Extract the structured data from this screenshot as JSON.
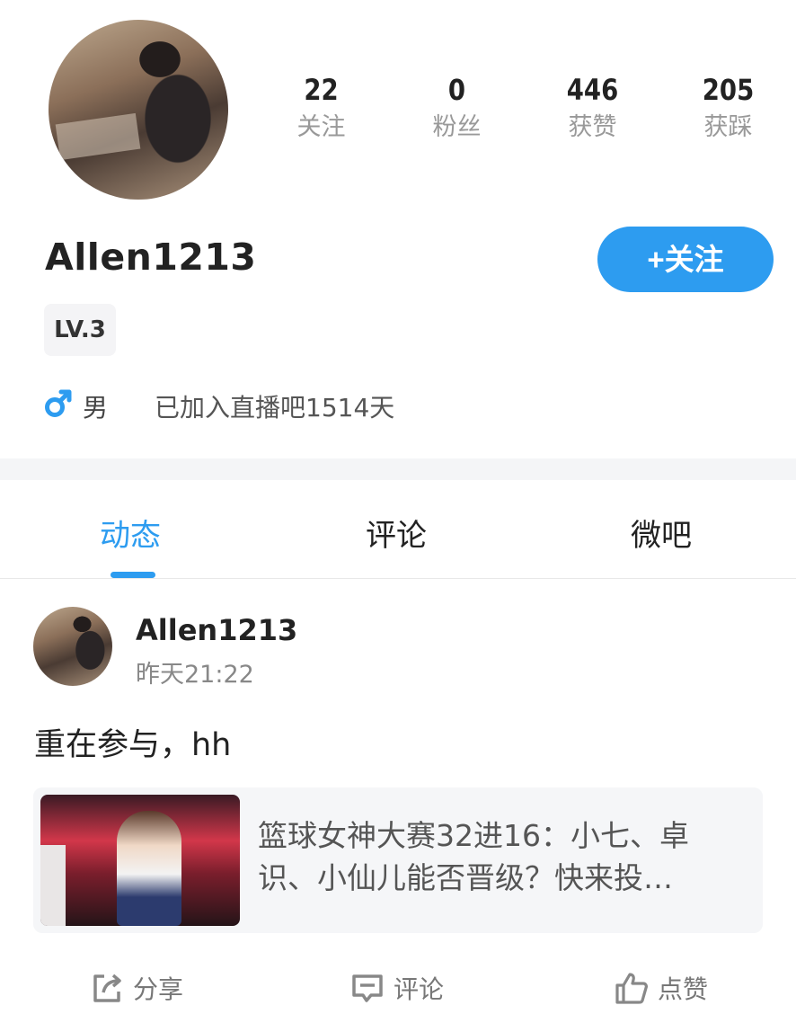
{
  "profile": {
    "username": "Allen1213",
    "level": "LV.3",
    "gender": "男",
    "joined": "已加入直播吧1514天",
    "follow_button": "+关注",
    "stats": [
      {
        "value": "22",
        "label": "关注"
      },
      {
        "value": "0",
        "label": "粉丝"
      },
      {
        "value": "446",
        "label": "获赞"
      },
      {
        "value": "205",
        "label": "获踩"
      }
    ]
  },
  "tabs": [
    {
      "label": "动态",
      "active": true
    },
    {
      "label": "评论",
      "active": false
    },
    {
      "label": "微吧",
      "active": false
    }
  ],
  "post": {
    "author": "Allen1213",
    "time": "昨天21:22",
    "text": "重在参与，hh",
    "link_title": "篮球女神大赛32进16：小七、卓识、小仙儿能否晋级？快来投…",
    "actions": {
      "share": "分享",
      "comment": "评论",
      "like": "点赞"
    }
  },
  "colors": {
    "accent": "#2d9cf0",
    "muted_text": "#999999",
    "section_bg": "#f4f5f7"
  }
}
